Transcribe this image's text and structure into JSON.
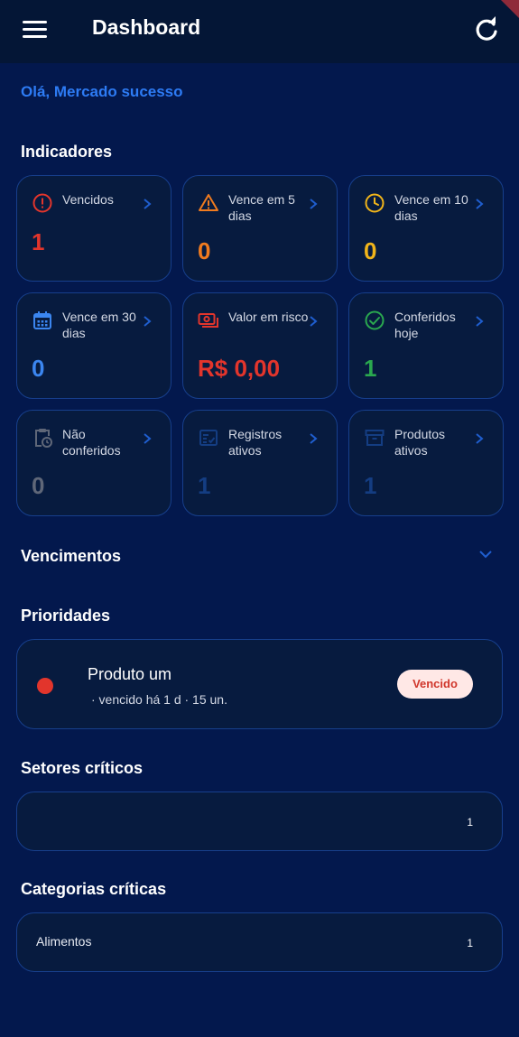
{
  "appbar": {
    "title": "Dashboard",
    "menu_icon": "menu-icon",
    "refresh_icon": "refresh-icon"
  },
  "greeting": "Olá, Mercado sucesso",
  "indicators": {
    "title": "Indicadores",
    "cards": [
      {
        "label": "Vencidos",
        "value": "1",
        "icon": "error-circle-icon",
        "color": "#e2352c"
      },
      {
        "label": "Vence em 5 dias",
        "value": "0",
        "icon": "warning-triangle-icon",
        "color": "#f07b1f"
      },
      {
        "label": "Vence em 10 dias",
        "value": "0",
        "icon": "clock-icon",
        "color": "#f0b41a"
      },
      {
        "label": "Vence em 30 dias",
        "value": "0",
        "icon": "calendar-icon",
        "color": "#3b86f0"
      },
      {
        "label": "Valor em risco",
        "value": "R$ 0,00",
        "icon": "money-icon",
        "color": "#e2352c"
      },
      {
        "label": "Conferidos hoje",
        "value": "1",
        "icon": "check-circle-icon",
        "color": "#2aa84f"
      },
      {
        "label": "Não conferidos",
        "value": "0",
        "icon": "clipboard-clock-icon",
        "color": "#5f6778"
      },
      {
        "label": "Registros ativos",
        "value": "1",
        "icon": "checklist-icon",
        "color": "#143d82"
      },
      {
        "label": "Produtos ativos",
        "value": "1",
        "icon": "archive-box-icon",
        "color": "#143d82"
      }
    ]
  },
  "vencimentos": {
    "title": "Vencimentos"
  },
  "prioridades": {
    "title": "Prioridades",
    "items": [
      {
        "name": "Produto um",
        "details": "· vencido há 1 d · 15 un.",
        "badge": "Vencido"
      }
    ]
  },
  "setores": {
    "title": "Setores críticos",
    "rows": [
      {
        "label": "",
        "count": "1"
      }
    ]
  },
  "categorias": {
    "title": "Categorias críticas",
    "rows": [
      {
        "label": "Alimentos",
        "count": "1"
      }
    ]
  }
}
